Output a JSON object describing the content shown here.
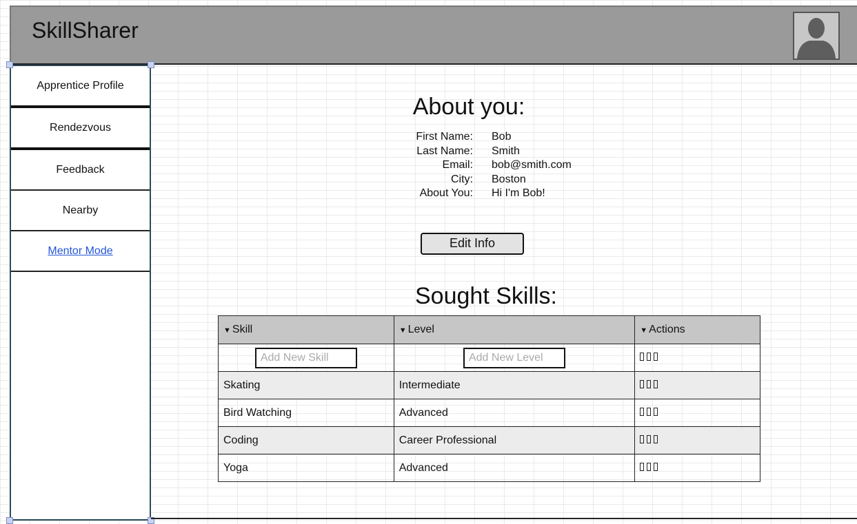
{
  "app": {
    "title": "SkillSharer"
  },
  "header": {
    "avatar_icon": "user-silhouette-icon"
  },
  "sidebar": {
    "items": [
      {
        "label": "Apprentice Profile"
      },
      {
        "label": "Rendezvous"
      },
      {
        "label": "Feedback"
      },
      {
        "label": "Nearby"
      },
      {
        "label": "Mentor Mode"
      }
    ]
  },
  "about": {
    "title": "About you:",
    "fields": [
      {
        "label": "First Name:",
        "value": "Bob"
      },
      {
        "label": "Last Name:",
        "value": "Smith"
      },
      {
        "label": "Email:",
        "value": "bob@smith.com"
      },
      {
        "label": "City:",
        "value": "Boston"
      },
      {
        "label": "About You:",
        "value": "Hi I'm Bob!"
      }
    ],
    "edit_button": "Edit Info"
  },
  "skills": {
    "title": "Sought Skills:",
    "headers": [
      "Skill",
      "Level",
      "Actions"
    ],
    "add_row": {
      "skill_placeholder": "Add New Skill",
      "level_placeholder": "Add New Level"
    },
    "rows": [
      {
        "skill": "Skating",
        "level": "Intermediate"
      },
      {
        "skill": "Bird Watching",
        "level": "Advanced"
      },
      {
        "skill": "Coding",
        "level": "Career Professional"
      },
      {
        "skill": "Yoga",
        "level": "Advanced"
      }
    ],
    "action_icon": "action-box-icon"
  },
  "colors": {
    "header_bg": "#9a9a9a",
    "link": "#2455d6",
    "table_header": "#c6c6c6",
    "row_alt": "#ececec"
  }
}
